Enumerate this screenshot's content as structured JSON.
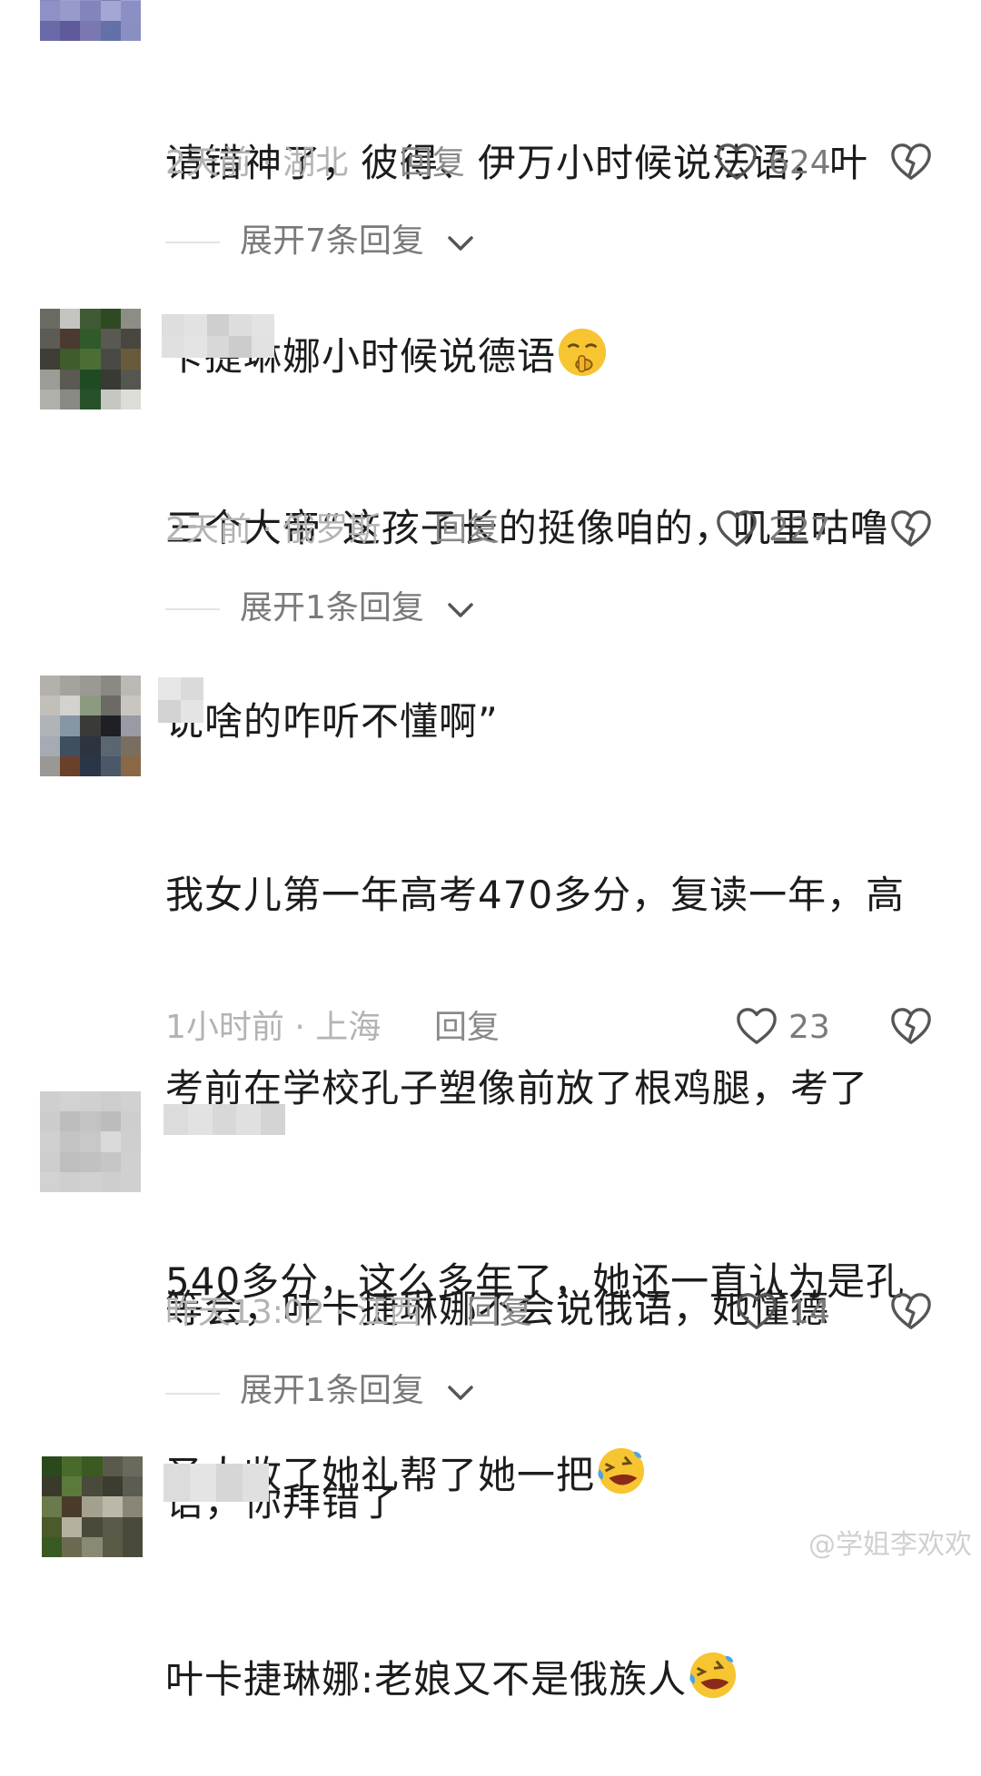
{
  "comments": [
    {
      "text_lines": [
        "请错神了，彼得、伊万小时候说法语，叶",
        "卡捷琳娜小时候说德语"
      ],
      "meta": "2天前 · 湖北",
      "reply_label": "回复",
      "likes": "624",
      "expand": "展开7条回复",
      "emoji": "shushing-face"
    },
    {
      "text_lines": [
        "三个大帝“这孩子长的挺像咱的，叽里咕噜",
        "说啥的咋听不懂啊”"
      ],
      "meta": "2天前 · 俄罗斯",
      "reply_label": "回复",
      "likes": "227",
      "expand": "展开1条回复"
    },
    {
      "text_lines": [
        "我女儿第一年高考470多分，复读一年，高",
        "考前在学校孔子塑像前放了根鸡腿，考了",
        "540多分，这么多年了，她还一直认为是孔",
        "圣人收了她礼帮了她一把"
      ],
      "meta": "1小时前 · 上海",
      "reply_label": "回复",
      "likes": "23",
      "emoji": "laughing-tears-face"
    },
    {
      "text_lines": [
        "等会，叶卡捷琳娜不会说俄语，她懂德",
        "语，你拜错了"
      ],
      "meta": "昨天13:02 · 江西",
      "reply_label": "回复",
      "likes": "14",
      "expand": "展开1条回复"
    },
    {
      "text_lines": [
        "叶卡捷琳娜:老娘又不是俄族人"
      ],
      "emoji": "laughing-tears-face"
    }
  ],
  "watermark": "@学姐李欢欢",
  "icons": {
    "like": "heart-outline-icon",
    "dislike": "broken-heart-icon",
    "expand": "chevron-down-icon"
  },
  "colors": {
    "meta": "#b3b3b3",
    "text": "#1c1c1c",
    "emoji": "#f7c531"
  }
}
